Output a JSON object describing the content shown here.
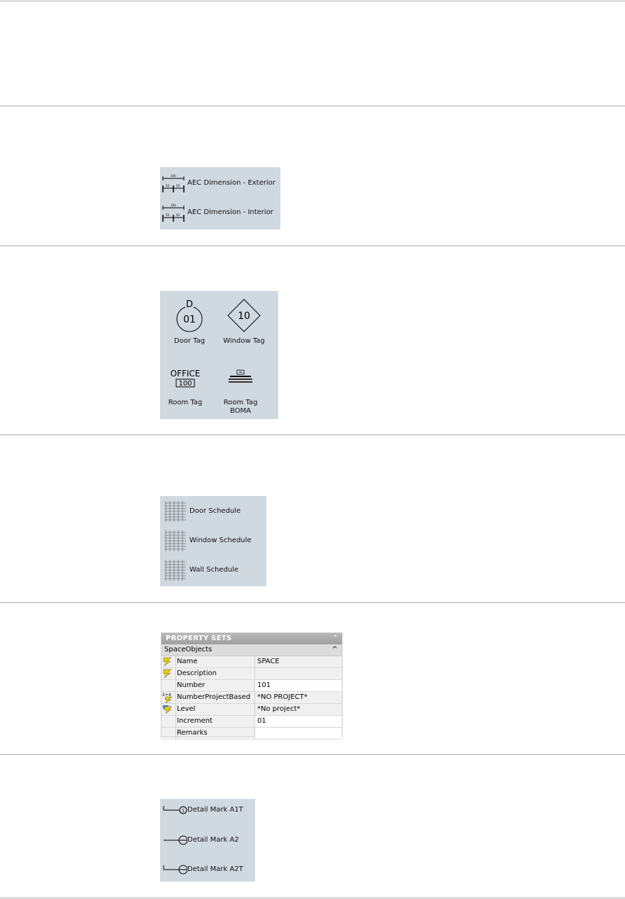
{
  "dimensions_palette": {
    "items": [
      {
        "label": "AEC Dimension - Exterior",
        "icon": "dimension-icon"
      },
      {
        "label": "AEC Dimension - Interior",
        "icon": "dimension-icon"
      }
    ],
    "icon_text": {
      "top": "100",
      "left": "50",
      "right": "50"
    }
  },
  "tags_palette": {
    "items": [
      {
        "label": "Door Tag",
        "icon": "door-tag-icon",
        "glyph_top": "D",
        "glyph_main": "01"
      },
      {
        "label": "Window Tag",
        "icon": "window-tag-icon",
        "glyph_main": "10"
      },
      {
        "label": "Room Tag",
        "icon": "room-tag-icon",
        "glyph_top": "OFFICE",
        "glyph_main": "100"
      },
      {
        "label": "Room Tag\nBOMA",
        "label_line1": "Room Tag",
        "label_line2": "BOMA",
        "icon": "room-tag-boma-icon"
      }
    ]
  },
  "schedules_palette": {
    "items": [
      {
        "label": "Door Schedule",
        "icon": "schedule-table-icon"
      },
      {
        "label": "Window Schedule",
        "icon": "schedule-table-icon"
      },
      {
        "label": "Wall Schedule",
        "icon": "schedule-table-icon"
      }
    ]
  },
  "property_sets": {
    "title": "PROPERTY SETS",
    "category": "SpaceObjects",
    "rows": [
      {
        "key": "Name",
        "value": "SPACE",
        "icon": "lightning-icon",
        "editable": false
      },
      {
        "key": "Description",
        "value": "",
        "icon": "lightning-icon",
        "editable": false
      },
      {
        "key": "Number",
        "value": "101",
        "icon": "",
        "editable": true
      },
      {
        "key": "NumberProjectBased",
        "value": "*NO PROJECT*",
        "icon": "formula-icon",
        "icon_text": "2+4",
        "editable": false
      },
      {
        "key": "Level",
        "value": "*No project*",
        "icon": "lightning-blue-icon",
        "editable": false
      },
      {
        "key": "Increment",
        "value": "01",
        "icon": "",
        "editable": true
      },
      {
        "key": "Remarks",
        "value": "",
        "icon": "",
        "editable": true
      }
    ],
    "colors": {
      "header": "#a8a8a8",
      "lightning": "#e8d000"
    }
  },
  "detail_marks_palette": {
    "items": [
      {
        "label": "Detail Mark A1T",
        "icon": "detail-mark-a1t-icon",
        "glyph": "1"
      },
      {
        "label": "Detail Mark A2",
        "icon": "detail-mark-a2-icon"
      },
      {
        "label": "Detail Mark A2T",
        "icon": "detail-mark-a2t-icon"
      }
    ]
  },
  "colors": {
    "panel": "#d0d8e0",
    "divider": "#aaaaaa"
  }
}
